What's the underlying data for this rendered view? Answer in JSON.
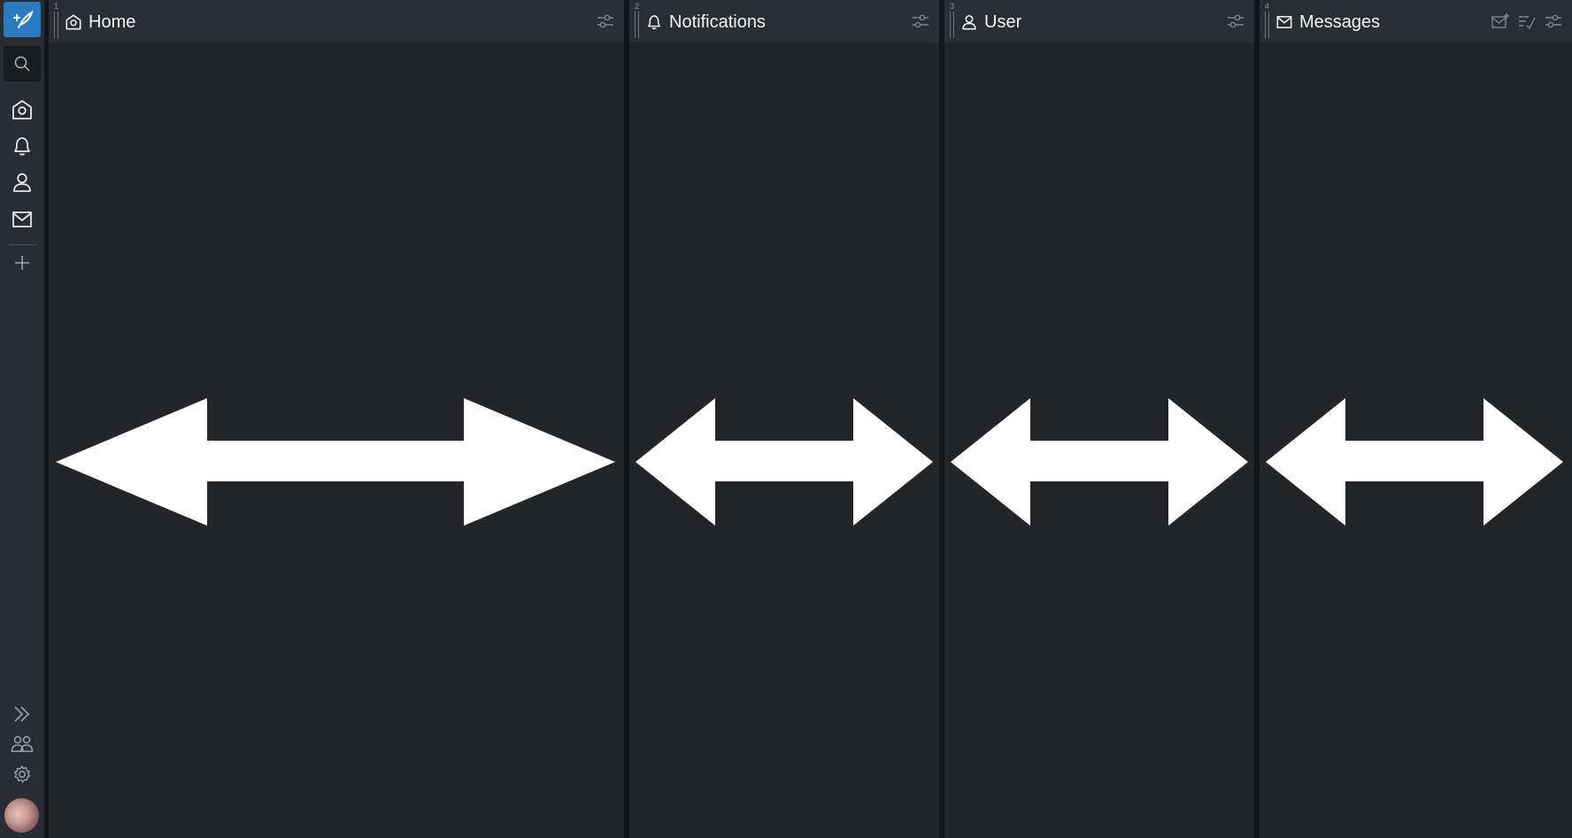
{
  "colors": {
    "background": "#14171a",
    "rail": "#292d32",
    "column": "#232528",
    "header": "#2a2e33",
    "accent": "#2b7bc2",
    "icon": "#e6e8ea",
    "muted_icon": "#7e858c",
    "arrow": "#ffffff"
  },
  "rail": {
    "compose_icon": "compose-icon",
    "search_icon": "search-icon",
    "items": [
      {
        "icon": "home-icon"
      },
      {
        "icon": "bell-icon"
      },
      {
        "icon": "user-icon"
      },
      {
        "icon": "envelope-icon"
      }
    ],
    "add_icon": "plus-icon",
    "bottom": [
      {
        "icon": "double-chevron-right-icon"
      },
      {
        "icon": "people-icon"
      },
      {
        "icon": "gear-icon"
      }
    ]
  },
  "columns": [
    {
      "index": "1",
      "title": "Home",
      "icon": "home-icon",
      "actions": [
        "sliders-icon"
      ]
    },
    {
      "index": "2",
      "title": "Notifications",
      "icon": "bell-icon",
      "actions": [
        "sliders-icon"
      ]
    },
    {
      "index": "3",
      "title": "User",
      "icon": "user-icon",
      "actions": [
        "sliders-icon"
      ]
    },
    {
      "index": "4",
      "title": "Messages",
      "icon": "envelope-icon",
      "actions": [
        "new-message-icon",
        "mark-read-icon",
        "sliders-icon"
      ]
    }
  ]
}
